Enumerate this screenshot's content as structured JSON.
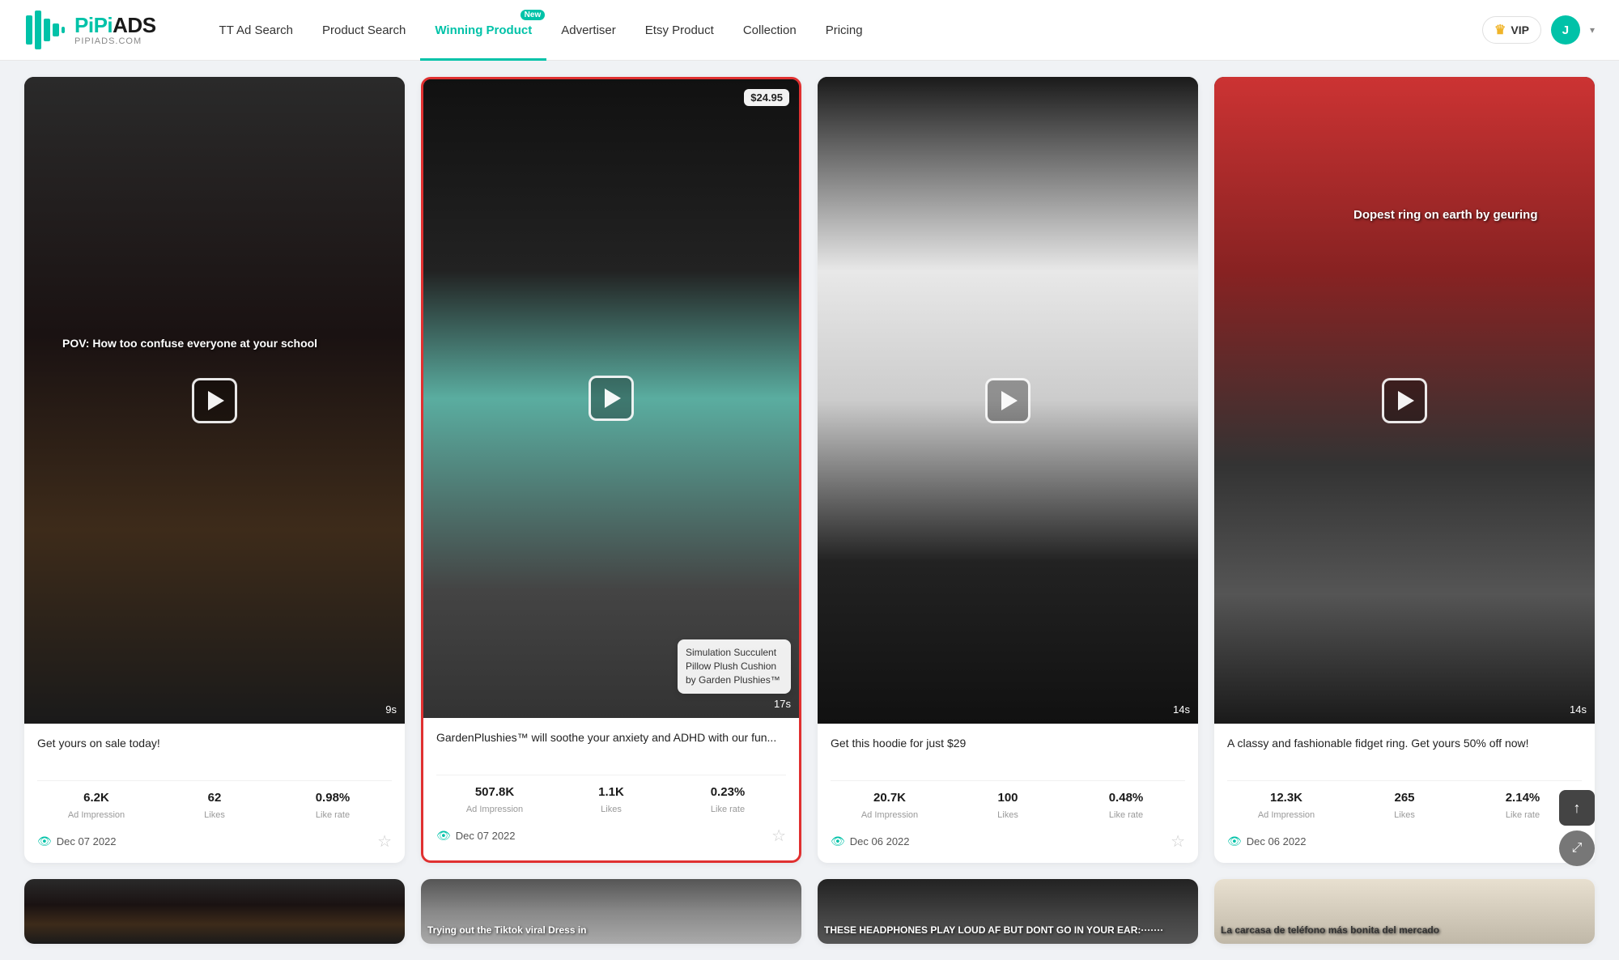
{
  "logo": {
    "main": "PiPiADS",
    "sub": "PIPIADS.COM"
  },
  "nav": {
    "items": [
      {
        "id": "tt-ad-search",
        "label": "TT Ad Search",
        "active": false,
        "badge": null
      },
      {
        "id": "product-search",
        "label": "Product Search",
        "active": false,
        "badge": null
      },
      {
        "id": "winning-product",
        "label": "Winning Product",
        "active": true,
        "badge": "New"
      },
      {
        "id": "advertiser",
        "label": "Advertiser",
        "active": false,
        "badge": null
      },
      {
        "id": "etsy-product",
        "label": "Etsy Product",
        "active": false,
        "badge": null
      },
      {
        "id": "collection",
        "label": "Collection",
        "active": false,
        "badge": null
      },
      {
        "id": "pricing",
        "label": "Pricing",
        "active": false,
        "badge": null
      }
    ],
    "vip_label": "VIP",
    "avatar_letter": "J"
  },
  "cards": [
    {
      "id": "card-1",
      "title": "Get yours on sale today!",
      "duration": "9s",
      "overlay_text": "POV: How too confuse everyone at your school",
      "ad_impression": "6.2K",
      "likes": "62",
      "like_rate": "0.98%",
      "date": "Dec 07 2022",
      "highlighted": false
    },
    {
      "id": "card-2",
      "title": "GardenPlushies™ will soothe your anxiety and ADHD with our fun...",
      "duration": "17s",
      "price_tag": "$24.95",
      "product_tooltip": "Simulation Succulent Pillow Plush Cushion by Garden Plushies™",
      "ad_impression": "507.8K",
      "likes": "1.1K",
      "like_rate": "0.23%",
      "date": "Dec 07 2022",
      "highlighted": true
    },
    {
      "id": "card-3",
      "title": "Get this hoodie for just $29",
      "duration": "14s",
      "ad_impression": "20.7K",
      "likes": "100",
      "like_rate": "0.48%",
      "date": "Dec 06 2022",
      "highlighted": false
    },
    {
      "id": "card-4",
      "title": "A classy and fashionable fidget ring. Get yours 50% off now!",
      "duration": "14s",
      "overlay_text_ring": "Dopest ring on earth by geuring",
      "ad_impression": "12.3K",
      "likes": "265",
      "like_rate": "2.14%",
      "date": "Dec 06 2022",
      "highlighted": false
    }
  ],
  "bottom_cards": [
    {
      "id": "bottom-1",
      "text": ""
    },
    {
      "id": "bottom-2",
      "text": "Trying out the Tiktok viral Dress in"
    },
    {
      "id": "bottom-3",
      "text": "THESE HEADPHONES PLAY LOUD AF BUT DONT GO IN YOUR EAR:·······"
    },
    {
      "id": "bottom-4",
      "text": "La carcasa de teléfono más bonita del mercado"
    }
  ],
  "labels": {
    "ad_impression": "Ad Impression",
    "likes": "Likes",
    "like_rate": "Like rate"
  }
}
